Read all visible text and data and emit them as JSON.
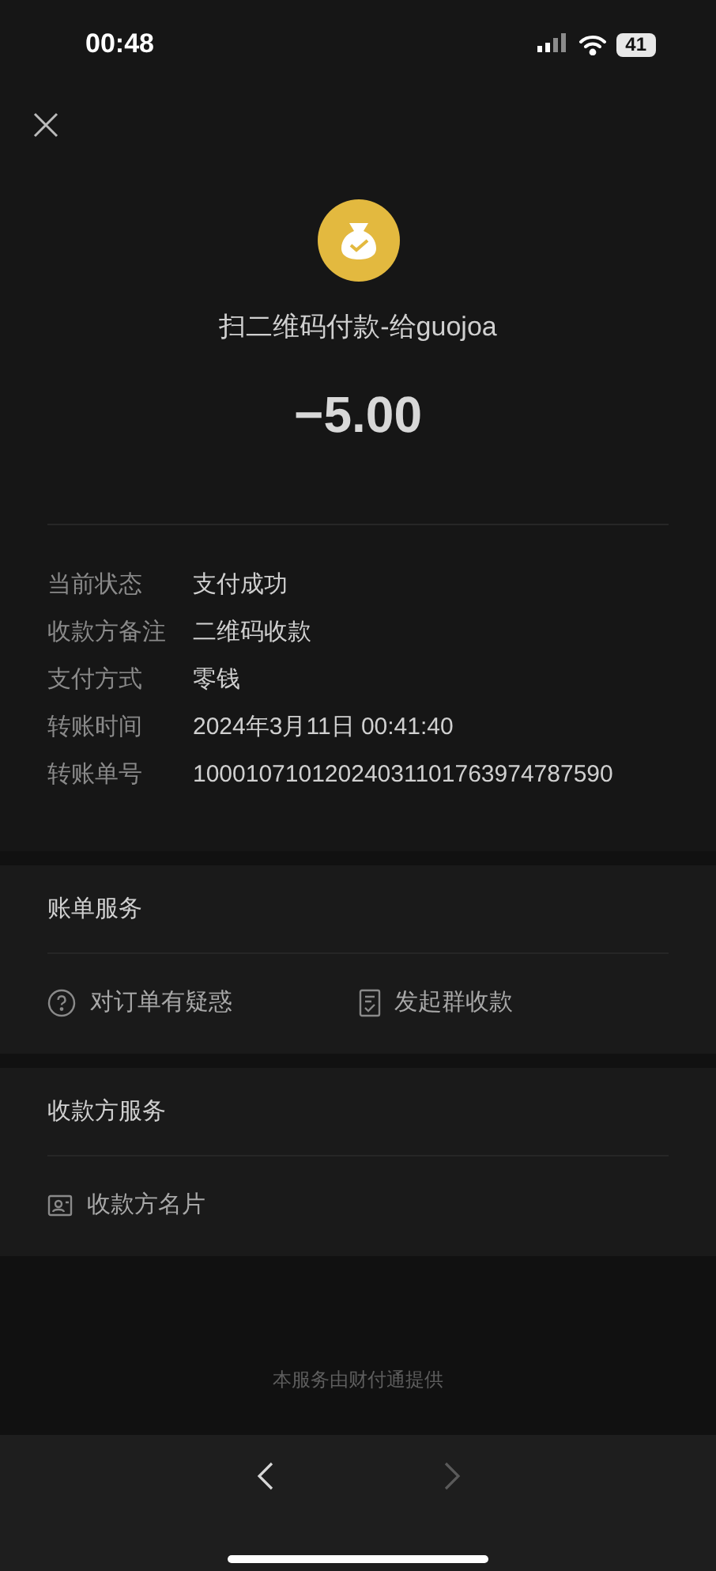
{
  "status_bar": {
    "time": "00:48",
    "battery": "41"
  },
  "header": {
    "title": "扫二维码付款-给guojoa",
    "amount": "−5.00"
  },
  "details": [
    {
      "label": "当前状态",
      "value": "支付成功"
    },
    {
      "label": "收款方备注",
      "value": "二维码收款"
    },
    {
      "label": "支付方式",
      "value": "零钱"
    },
    {
      "label": "转账时间",
      "value": "2024年3月11日 00:41:40"
    },
    {
      "label": "转账单号",
      "value": "10001071012024031101763974787590"
    }
  ],
  "sections": [
    {
      "title": "账单服务",
      "actions": [
        {
          "kind": "question",
          "label": "对订单有疑惑"
        },
        {
          "kind": "document",
          "label": "发起群收款"
        }
      ]
    },
    {
      "title": "收款方服务",
      "actions": [
        {
          "kind": "card",
          "label": "收款方名片"
        }
      ]
    }
  ],
  "footer": "本服务由财付通提供",
  "nav": [
    {
      "kind": "back",
      "disabled": false
    },
    {
      "kind": "forward",
      "disabled": true
    }
  ]
}
